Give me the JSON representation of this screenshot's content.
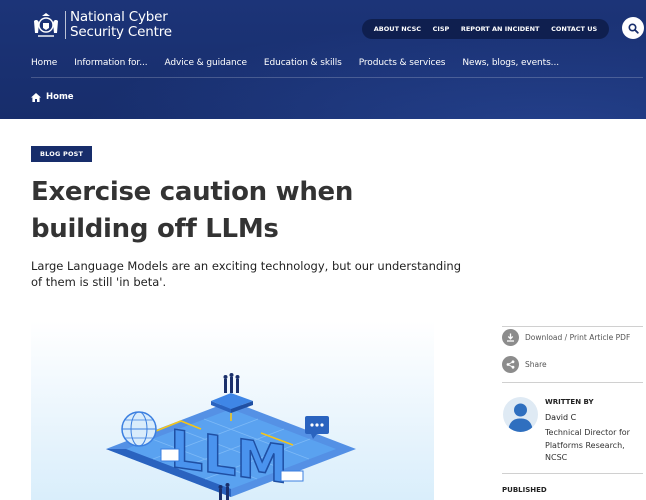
{
  "logo": {
    "line1": "National Cyber",
    "line2": "Security Centre"
  },
  "utility_nav": [
    {
      "label": "ABOUT NCSC"
    },
    {
      "label": "CISP"
    },
    {
      "label": "REPORT AN INCIDENT"
    },
    {
      "label": "CONTACT US"
    }
  ],
  "main_nav": [
    {
      "label": "Home"
    },
    {
      "label": "Information for..."
    },
    {
      "label": "Advice & guidance"
    },
    {
      "label": "Education & skills"
    },
    {
      "label": "Products & services"
    },
    {
      "label": "News, blogs, events..."
    }
  ],
  "breadcrumb": {
    "label": "Home"
  },
  "article": {
    "tag": "BLOG POST",
    "title": "Exercise caution when building off LLMs",
    "summary": "Large Language Models are an exciting technology, but our understanding of them is still 'in beta'.",
    "hero_text": "LLM"
  },
  "sidebar": {
    "download_label": "Download / Print Article PDF",
    "share_label": "Share",
    "written_by_label": "WRITTEN BY",
    "author_name": "David C",
    "author_role": "Technical Director for Platforms Research, NCSC",
    "published_label": "PUBLISHED"
  },
  "colors": {
    "header": "#1c3478",
    "tag": "#172d6b",
    "utility_pill": "#0f1f4f"
  }
}
